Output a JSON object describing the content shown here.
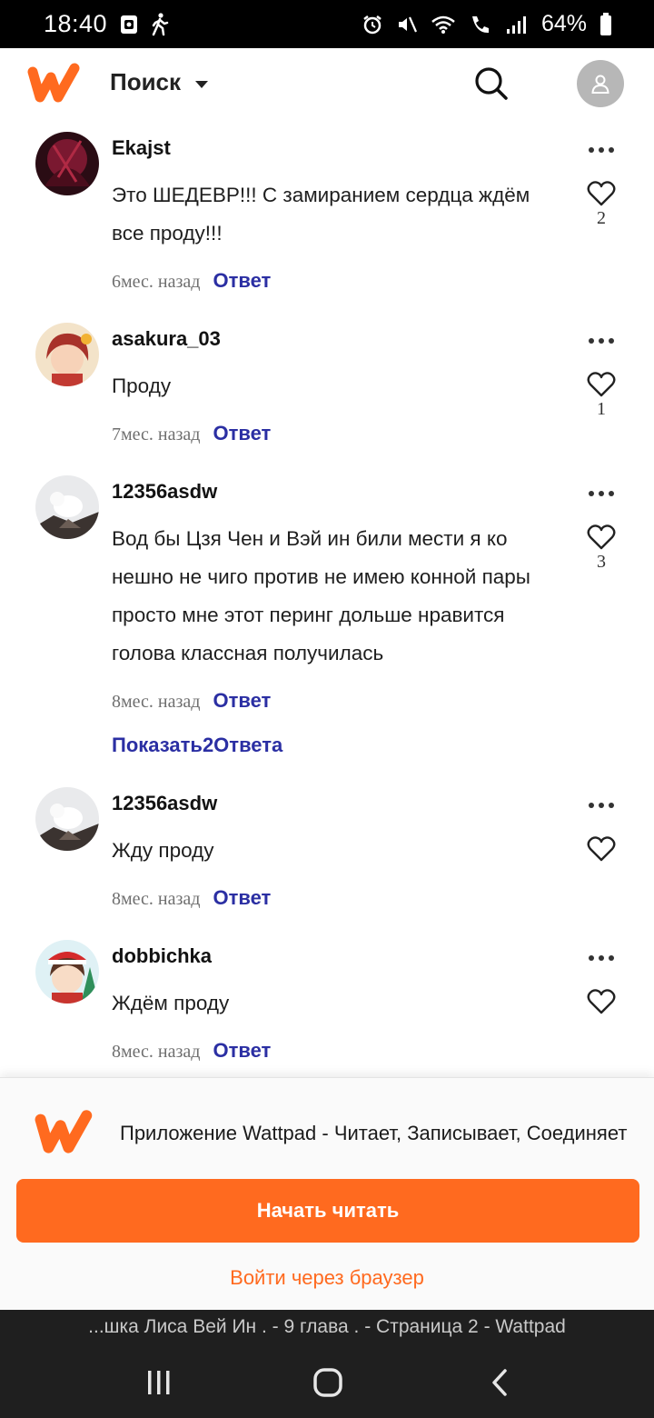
{
  "status_bar": {
    "time": "18:40",
    "battery": "64%"
  },
  "header": {
    "menu_label": "Поиск"
  },
  "comments": [
    {
      "author": "Ekajst",
      "text": "Это ШЕДЕВР!!! С замиранием сердца ждём все проду!!!",
      "time": "6мес. назад",
      "reply": "Ответ",
      "likes": "2"
    },
    {
      "author": "asakura_03",
      "text": "Проду",
      "time": "7мес. назад",
      "reply": "Ответ",
      "likes": "1"
    },
    {
      "author": "12356asdw",
      "text": "Вод бы Цзя Чен и Вэй ин били мести я ко нешно не чиго против не имею конной пары просто мне этот перинг дольше нравится голова классная получилась",
      "time": "8мес. назад",
      "reply": "Ответ",
      "likes": "3",
      "show_replies": "Показать2Ответа"
    },
    {
      "author": "12356asdw",
      "text": "Жду проду",
      "time": "8мес. назад",
      "reply": "Ответ"
    },
    {
      "author": "dobbichka",
      "text": "Ждём проду",
      "time": "8мес. назад",
      "reply": "Ответ"
    }
  ],
  "sheet": {
    "app_text": "Приложение Wattpad - Читает, Записывает, Соединяет",
    "start_button": "Начать читать",
    "browser_link": "Войти через браузер"
  },
  "browser": {
    "page_title": "...шка Лиса Вей Ин . - 9 глава . - Страница 2 - Wattpad"
  },
  "colors": {
    "brand_orange": "#ff6a1f",
    "link_blue": "#2b2fa3"
  }
}
